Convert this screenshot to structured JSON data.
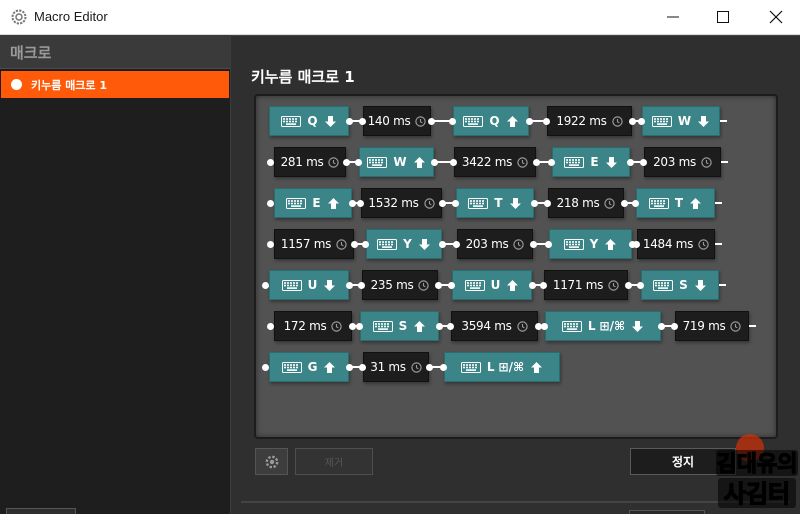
{
  "window": {
    "title": "Macro Editor",
    "app_icon": "steelseries-gear-icon"
  },
  "sidebar": {
    "header": "매크로",
    "items": [
      {
        "label": "키누름 매크로 1",
        "selected": true
      }
    ]
  },
  "editor": {
    "macro_title": "키누름 매크로 1",
    "steps": [
      {
        "type": "key",
        "key": "Q",
        "dir": "down"
      },
      {
        "type": "delay",
        "label": "140 ms"
      },
      {
        "type": "key",
        "key": "Q",
        "dir": "up"
      },
      {
        "type": "delay",
        "label": "1922 ms"
      },
      {
        "type": "key",
        "key": "W",
        "dir": "down"
      },
      {
        "type": "delay",
        "label": "281 ms"
      },
      {
        "type": "key",
        "key": "W",
        "dir": "up"
      },
      {
        "type": "delay",
        "label": "3422 ms"
      },
      {
        "type": "key",
        "key": "E",
        "dir": "down"
      },
      {
        "type": "delay",
        "label": "203 ms"
      },
      {
        "type": "key",
        "key": "E",
        "dir": "up"
      },
      {
        "type": "delay",
        "label": "1532 ms"
      },
      {
        "type": "key",
        "key": "T",
        "dir": "down"
      },
      {
        "type": "delay",
        "label": "218 ms"
      },
      {
        "type": "key",
        "key": "T",
        "dir": "up"
      },
      {
        "type": "delay",
        "label": "1157 ms"
      },
      {
        "type": "key",
        "key": "Y",
        "dir": "down"
      },
      {
        "type": "delay",
        "label": "203 ms"
      },
      {
        "type": "key",
        "key": "Y",
        "dir": "up"
      },
      {
        "type": "delay",
        "label": "1484 ms"
      },
      {
        "type": "key",
        "key": "U",
        "dir": "down"
      },
      {
        "type": "delay",
        "label": "235 ms"
      },
      {
        "type": "key",
        "key": "U",
        "dir": "up"
      },
      {
        "type": "delay",
        "label": "1171 ms"
      },
      {
        "type": "key",
        "key": "S",
        "dir": "down"
      },
      {
        "type": "delay",
        "label": "172 ms"
      },
      {
        "type": "key",
        "key": "S",
        "dir": "up"
      },
      {
        "type": "delay",
        "label": "3594 ms"
      },
      {
        "type": "key",
        "key": "L",
        "mod": "⊞/⌘",
        "dir": "down"
      },
      {
        "type": "delay",
        "label": "719 ms"
      },
      {
        "type": "key",
        "key": "G",
        "dir": "up"
      },
      {
        "type": "delay",
        "label": "31 ms"
      },
      {
        "type": "key",
        "key": "L",
        "mod": "⊞/⌘",
        "dir": "up"
      }
    ],
    "disabled_button_label": "제거",
    "stop_button_label": "정지"
  },
  "watermark": {
    "line1": "김대유의",
    "line2": "사김터"
  },
  "colors": {
    "accent": "#ff5a0a",
    "key_chip": "#3b8488",
    "delay_chip": "#1d1d1d",
    "canvas": "#525252",
    "panel": "#2f2f2f"
  }
}
